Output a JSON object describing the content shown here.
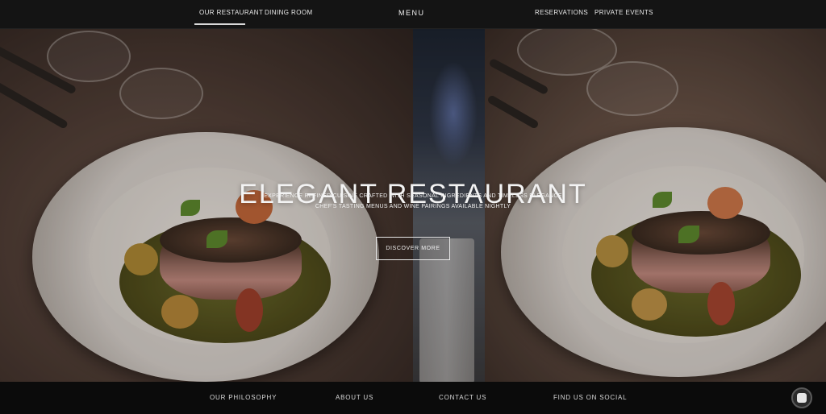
{
  "topnav": {
    "links": [
      {
        "label": "OUR RESTAURANT"
      },
      {
        "label": "DINING ROOM"
      },
      {
        "label": "RESERVATIONS"
      },
      {
        "label": "PRIVATE EVENTS"
      }
    ],
    "brand": "MENU"
  },
  "hero": {
    "title": "ELEGANT RESTAURANT",
    "subtitle_line1": "EXPERIENCE REFINED CUISINE CRAFTED WITH SEASONAL INGREDIENTS AND TIMELESS ELEGANCE",
    "subtitle_line2": "CHEF'S TASTING MENUS AND WINE PAIRINGS AVAILABLE NIGHTLY",
    "cta_label": "DISCOVER MORE"
  },
  "bottomnav": {
    "links": [
      {
        "label": "OUR PHILOSOPHY"
      },
      {
        "label": "ABOUT US"
      },
      {
        "label": "CONTACT US"
      },
      {
        "label": "FIND US ON SOCIAL"
      }
    ]
  },
  "colors": {
    "nav_bg": "#141414",
    "footer_bg": "#0b0b0b",
    "text_light": "#f3f3f3"
  },
  "icons": {
    "chat": "chat-icon"
  }
}
